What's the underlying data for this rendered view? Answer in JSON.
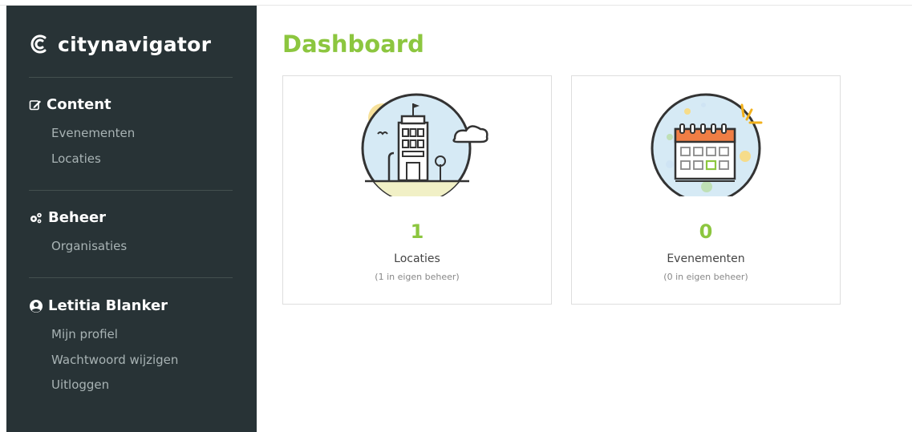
{
  "brand": {
    "name": "citynavigator"
  },
  "sidebar": {
    "sections": [
      {
        "title": "Content",
        "icon": "edit-icon",
        "items": [
          {
            "label": "Evenementen"
          },
          {
            "label": "Locaties"
          }
        ]
      },
      {
        "title": "Beheer",
        "icon": "gears-icon",
        "items": [
          {
            "label": "Organisaties"
          }
        ]
      },
      {
        "title": "Letitia Blanker",
        "icon": "user-circle-icon",
        "items": [
          {
            "label": "Mijn profiel"
          },
          {
            "label": "Wachtwoord wijzigen"
          },
          {
            "label": "Uitloggen"
          }
        ]
      }
    ]
  },
  "main": {
    "title": "Dashboard",
    "cards": [
      {
        "count": "1",
        "label": "Locaties",
        "sub": "(1 in eigen beheer)",
        "icon": "city-building-icon"
      },
      {
        "count": "0",
        "label": "Evenementen",
        "sub": "(0 in eigen beheer)",
        "icon": "calendar-icon"
      }
    ]
  },
  "colors": {
    "sidebar_bg": "#283336",
    "accent_green": "#8cc63f",
    "nav_text": "#a8b3b4"
  }
}
